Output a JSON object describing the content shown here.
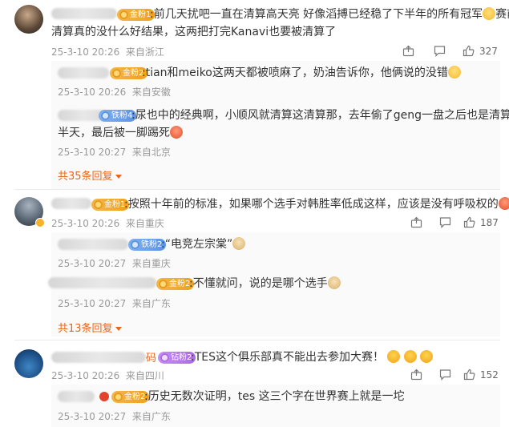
{
  "comments": [
    {
      "badge": "金粉1",
      "text_line1": ":前几天扰吧一直在清算高天亮 好像滔搏已经稳了下半年的所有冠军",
      "text_line2": "赛前",
      "text_line3": "清算真的没什么好结果，这两把打完Kanavi也要被清算了",
      "time": "25-3-10 20:26",
      "location": "来自浙江",
      "likes": "327",
      "replies": [
        {
          "badge": "金粉2",
          "text": ":tian和meiko这两天都被喷麻了，奶油告诉你，他俩说的没错",
          "time": "25-3-10 20:26",
          "location": "来自安徽"
        },
        {
          "badge": "铁粉4",
          "text_line1": ":尿也中的经典啊，小顺风就清算这清算那，去年偷了geng一盘之后也是清算",
          "text_line2": "半天，最后被一脚踢死",
          "time": "25-3-10 20:27",
          "location": "来自北京"
        }
      ],
      "more": "共35条回复"
    },
    {
      "badge": "金粉1",
      "text": ":按照十年前的标准，如果哪个选手对韩胜率低成这样，应该是没有呼吸权的",
      "time": "25-3-10 20:26",
      "location": "来自重庆",
      "likes": "187",
      "replies": [
        {
          "badge": "铁粉2",
          "text": ":“电竞左宗棠”",
          "time": "25-3-10 20:27",
          "location": "来自重庆"
        },
        {
          "badge": "金粉2",
          "text": ":不懂就问，说的是哪个选手",
          "time": "25-3-10 20:27",
          "location": "来自广东"
        }
      ],
      "more": "共13条回复"
    },
    {
      "name_tail": "码",
      "badge": "钻粉2",
      "text": ":TES这个俱乐部真不能出去参加大赛！",
      "time": "25-3-10 20:26",
      "location": "来自四川",
      "likes": "152",
      "replies": [
        {
          "badge": "金粉2",
          "text": ":历史无数次证明，tes 这三个字在世界赛上就是一坨",
          "time": "25-3-10 20:27",
          "location": "来自广东"
        }
      ]
    }
  ],
  "colors": {
    "accent": "#e8651a",
    "meta": "#999999",
    "text": "#333333"
  },
  "icons": [
    "share-icon",
    "comment-icon",
    "like-icon"
  ]
}
